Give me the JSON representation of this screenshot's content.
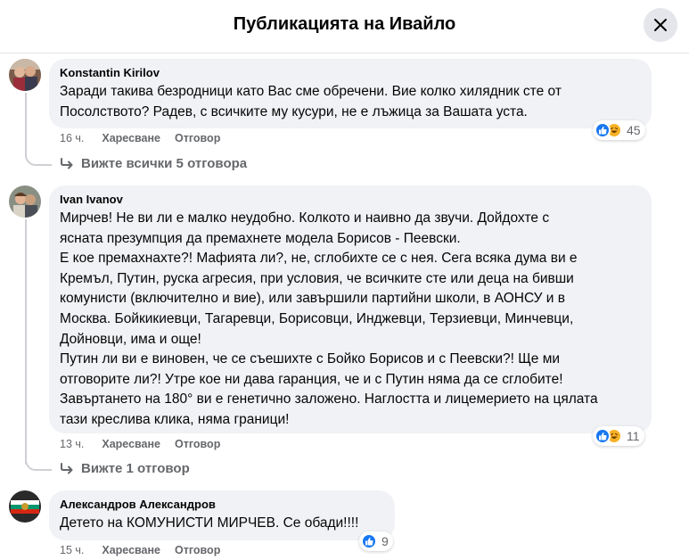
{
  "header": {
    "title": "Публикацията на Ивайло"
  },
  "comments": [
    {
      "author": "Konstantin Kirilov",
      "text": "Заради такива безродници като Вас сме обречени. Вие колко хилядник сте от\nПосолството? Радев, с всичките му кусури, не е лъжица за Вашата уста.",
      "time": "16 ч.",
      "like": "Харесване",
      "reply": "Отговор",
      "reactions_count": "45",
      "view_replies": "Вижте всички 5 отговора"
    },
    {
      "author": "Ivan Ivanov",
      "text": "Мирчев! Не ви ли е малко неудобно. Колкото и наивно да звучи. Дойдохте с\nясната презумпция да премахнете модела Борисов - Пеевски.\nЕ кое премахнахте?! Мафията ли?, не, сглобихте се с нея. Сега всяка дума ви е\nКремъл, Путин, руска агресия, при условия, че всичките сте или деца на бивши\nкомунисти (включително и вие), или завършили партийни школи, в АОНСУ и в\nМосква. Бойкикиевци, Тагаревци, Борисовци, Инджевци, Терзиевци, Минчевци,\nДойновци, има и още!\nПутин ли ви е виновен, че се съешихте с Бойко Борисов и с Пеевски?! Ще ми\nотговорите ли?! Утре кое ни дава гаранция, че и с Путин няма да се сглобите!\nЗавъртането на 180° ви е генетично заложено. Наглостта и лицемерието на цялата\nтази креслива клика, няма граници!",
      "time": "13 ч.",
      "like": "Харесване",
      "reply": "Отговор",
      "reactions_count": "11",
      "view_replies": "Вижте 1 отговор"
    },
    {
      "author": "Александров Александров",
      "text": "Детето на КОМУНИСТИ МИРЧЕВ. Се обади!!!!",
      "time": "15 ч.",
      "like": "Харесване",
      "reply": "Отговор",
      "reactions_count": "9"
    }
  ],
  "icons": {
    "close": "close-icon",
    "like": "like-reaction-icon",
    "haha": "haha-reaction-icon",
    "reply_arrow": "reply-arrow-icon"
  },
  "colors": {
    "like": "#1877f2",
    "haha": "#f7b125",
    "bubble": "#f0f2f5",
    "muted": "#65676b"
  }
}
